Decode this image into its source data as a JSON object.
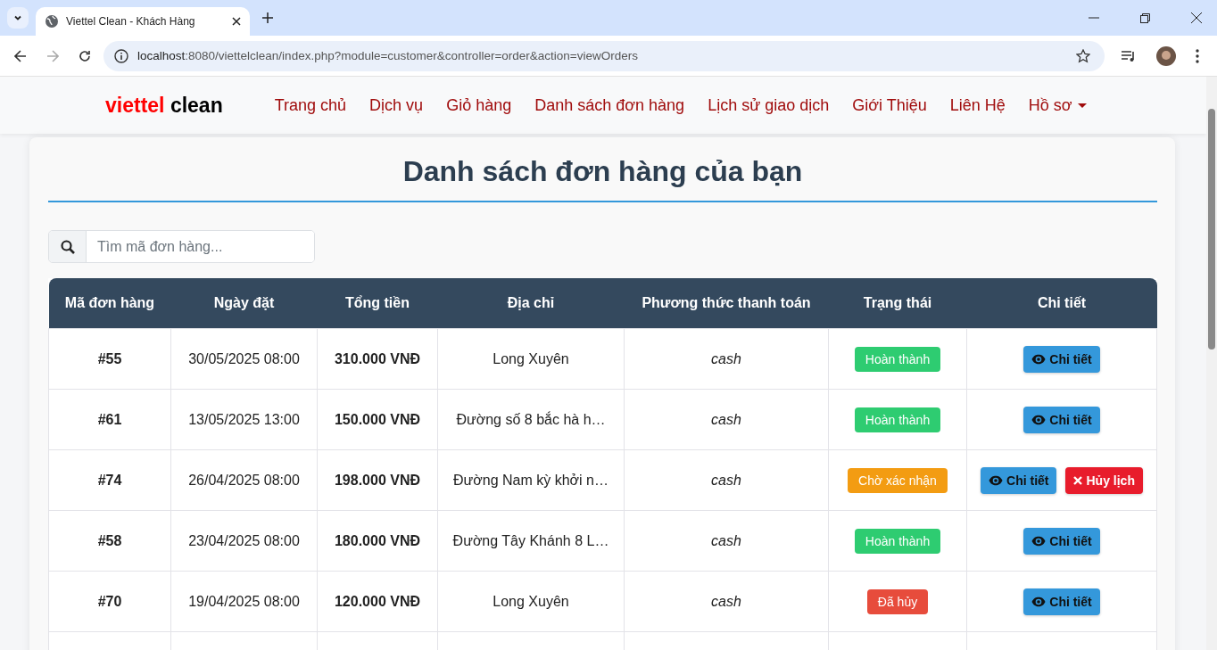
{
  "browser": {
    "tab_title": "Viettel Clean - Khách Hàng",
    "url_host": "localhost",
    "url_rest": ":8080/viettelclean/index.php?module=customer&controller=order&action=viewOrders"
  },
  "navbar": {
    "brand_red": "viettel",
    "brand_black": "clean",
    "links": [
      {
        "label": "Trang chủ"
      },
      {
        "label": "Dịch vụ"
      },
      {
        "label": "Giỏ hàng"
      },
      {
        "label": "Danh sách đơn hàng"
      },
      {
        "label": "Lịch sử giao dịch"
      },
      {
        "label": "Giới Thiệu"
      },
      {
        "label": "Liên Hệ"
      },
      {
        "label": "Hồ sơ",
        "dropdown": true
      }
    ]
  },
  "page": {
    "title": "Danh sách đơn hàng của bạn",
    "search": {
      "placeholder": "Tìm mã đơn hàng..."
    }
  },
  "table": {
    "columns": [
      "Mã đơn hàng",
      "Ngày đặt",
      "Tổng tiền",
      "Địa chỉ",
      "Phương thức thanh toán",
      "Trạng thái",
      "Chi tiết"
    ],
    "rows": [
      {
        "id": "#55",
        "date": "30/05/2025 08:00",
        "total": "310.000 VNĐ",
        "address": "Long Xuyên",
        "payment": "cash",
        "status": {
          "label": "Hoàn thành",
          "kind": "done"
        },
        "actions": [
          {
            "label": "Chi tiết",
            "kind": "view"
          }
        ]
      },
      {
        "id": "#61",
        "date": "13/05/2025 13:00",
        "total": "150.000 VNĐ",
        "address": "Đường số 8 bắc hà h…",
        "payment": "cash",
        "status": {
          "label": "Hoàn thành",
          "kind": "done"
        },
        "actions": [
          {
            "label": "Chi tiết",
            "kind": "view"
          }
        ]
      },
      {
        "id": "#74",
        "date": "26/04/2025 08:00",
        "total": "198.000 VNĐ",
        "address": "Đường Nam kỳ khởi n…",
        "payment": "cash",
        "status": {
          "label": "Chờ xác nhận",
          "kind": "pending"
        },
        "actions": [
          {
            "label": "Chi tiết",
            "kind": "view"
          },
          {
            "label": "Hủy lịch",
            "kind": "cancel"
          }
        ]
      },
      {
        "id": "#58",
        "date": "23/04/2025 08:00",
        "total": "180.000 VNĐ",
        "address": "Đường Tây Khánh 8 L…",
        "payment": "cash",
        "status": {
          "label": "Hoàn thành",
          "kind": "done"
        },
        "actions": [
          {
            "label": "Chi tiết",
            "kind": "view"
          }
        ]
      },
      {
        "id": "#70",
        "date": "19/04/2025 08:00",
        "total": "120.000 VNĐ",
        "address": "Long Xuyên",
        "payment": "cash",
        "status": {
          "label": "Đã hủy",
          "kind": "cancelled"
        },
        "actions": [
          {
            "label": "Chi tiết",
            "kind": "view"
          }
        ]
      }
    ]
  }
}
